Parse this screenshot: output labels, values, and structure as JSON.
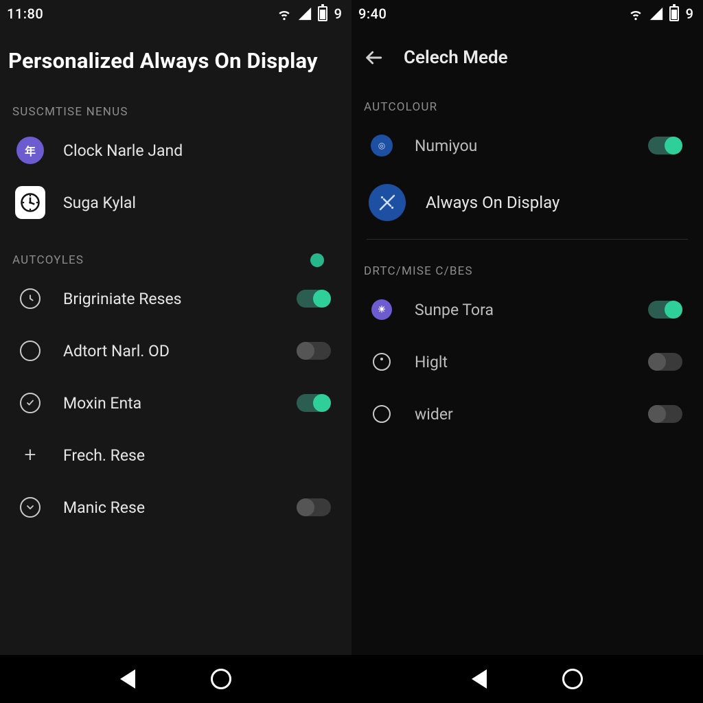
{
  "left": {
    "status": {
      "time": "11:80",
      "battery_digit": "9"
    },
    "title": "Personalized Always On Display",
    "section1_label": "SUSCMTISE NENUS",
    "section2_label": "AUTCOYLES",
    "items_top": [
      {
        "label": "Clock Narle Jand"
      },
      {
        "label": "Suga Kylal"
      }
    ],
    "items_bottom": [
      {
        "label": "Brigriniate Reses",
        "toggle": true,
        "has_toggle": true
      },
      {
        "label": "Adtort Narl. OD",
        "toggle": false,
        "has_toggle": true
      },
      {
        "label": "Moxin Enta",
        "toggle": true,
        "has_toggle": true
      },
      {
        "label": "Frech. Rese",
        "has_toggle": false
      },
      {
        "label": "Manic Rese",
        "toggle": false,
        "has_toggle": true
      }
    ]
  },
  "right": {
    "status": {
      "time": "9:40",
      "battery_digit": "9"
    },
    "title": "Celech Mede",
    "section1_label": "AUTCOLOUR",
    "section2_label": "DRTC/MISE C/BES",
    "items_top": [
      {
        "label": "Numiyou",
        "toggle": true,
        "has_toggle": true
      },
      {
        "label": "Always On Display",
        "has_toggle": false
      }
    ],
    "items_bottom": [
      {
        "label": "Sunpe Tora",
        "toggle": true,
        "has_toggle": true
      },
      {
        "label": "Higlt",
        "toggle": false,
        "has_toggle": true
      },
      {
        "label": "wider",
        "toggle": false,
        "has_toggle": true
      }
    ]
  }
}
